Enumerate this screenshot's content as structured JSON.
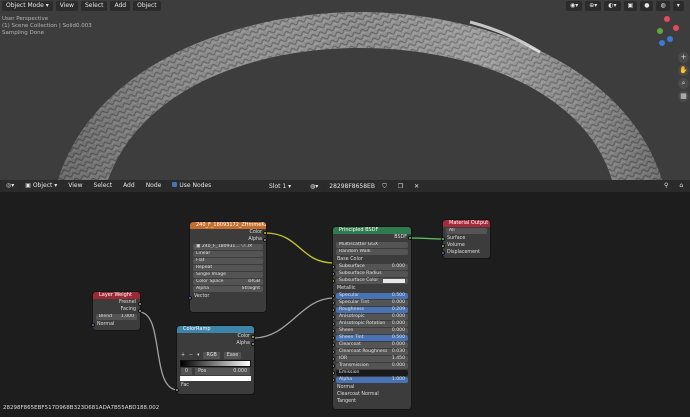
{
  "viewport": {
    "mode_label": "Object Mode",
    "menu": [
      "View",
      "Select",
      "Add",
      "Object"
    ],
    "overlay_lines": [
      "User Perspective",
      "(1) Scene Collection | Solid0.003",
      "Sampling Done"
    ]
  },
  "node_editor": {
    "type_label": "Object",
    "menu": [
      "View",
      "Select",
      "Add",
      "Node"
    ],
    "use_nodes_label": "Use Nodes",
    "slot_label": "Slot 1",
    "material_name": "28298F8658EBF51...",
    "footer_id": "28298F865EBF517D968B323D681ADA7B55ABD188.002"
  },
  "nodes": {
    "image": {
      "title": "240_F_18093172_ZHmmeKzLjpg.001",
      "out_color": "Color",
      "out_alpha": "Alpha",
      "image_name": "240_F_180931...",
      "interpolation": "Linear",
      "projection": "Flat",
      "extension": "Repeat",
      "source": "Single Image",
      "color_space_label": "Color Space",
      "color_space": "sRGB",
      "alpha_label": "Alpha",
      "alpha_value": "Straight",
      "in_vector": "Vector"
    },
    "layer_weight": {
      "title": "Layer Weight",
      "out_fresnel": "Fresnel",
      "out_facing": "Facing",
      "blend_label": "Blend",
      "blend_value": "1.000",
      "in_normal": "Normal"
    },
    "colorramp": {
      "title": "ColorRamp",
      "out_color": "Color",
      "out_alpha": "Alpha",
      "plus": "+",
      "minus": "−",
      "mode": "RGB",
      "interp": "Ease",
      "stop_index": "0",
      "pos_label": "Pos",
      "pos_value": "0.000",
      "in_fac": "Fac"
    },
    "bsdf": {
      "title": "Principled BSDF",
      "out_bsdf": "BSDF",
      "distribution": "Multiscatter GGX",
      "subsurface_method": "Random Walk",
      "fields": [
        {
          "label": "Base Color",
          "value": "",
          "type": "socket-y"
        },
        {
          "label": "Subsurface",
          "value": "0.000",
          "type": "field"
        },
        {
          "label": "Subsurface Radius",
          "value": "",
          "type": "dropdown"
        },
        {
          "label": "Subsurface Color",
          "value": "",
          "type": "color"
        },
        {
          "label": "Metallic",
          "value": "",
          "type": "socket-g"
        },
        {
          "label": "Specular",
          "value": "0.500",
          "type": "blue"
        },
        {
          "label": "Specular Tint",
          "value": "0.000",
          "type": "field"
        },
        {
          "label": "Roughness",
          "value": "0.209",
          "type": "blue"
        },
        {
          "label": "Anisotropic",
          "value": "0.000",
          "type": "field"
        },
        {
          "label": "Anisotropic Rotation",
          "value": "0.000",
          "type": "field"
        },
        {
          "label": "Sheen",
          "value": "0.000",
          "type": "field"
        },
        {
          "label": "Sheen Tint",
          "value": "0.500",
          "type": "blue"
        },
        {
          "label": "Clearcoat",
          "value": "0.000",
          "type": "field"
        },
        {
          "label": "Clearcoat Roughness",
          "value": "0.030",
          "type": "field"
        },
        {
          "label": "IOR",
          "value": "1.450",
          "type": "field"
        },
        {
          "label": "Transmission",
          "value": "0.000",
          "type": "field"
        },
        {
          "label": "Emission",
          "value": "",
          "type": "dark"
        },
        {
          "label": "Alpha",
          "value": "1.000",
          "type": "blue"
        },
        {
          "label": "Normal",
          "value": "",
          "type": "socket-p"
        },
        {
          "label": "Clearcoat Normal",
          "value": "",
          "type": "socket-p"
        },
        {
          "label": "Tangent",
          "value": "",
          "type": "socket-p"
        }
      ]
    },
    "output": {
      "title": "Material Output",
      "target": "All",
      "in_surface": "Surface",
      "in_volume": "Volume",
      "in_displacement": "Displacement"
    }
  },
  "colors": {
    "image_header": "#c46e2e",
    "input_header": "#9a2a35",
    "converter_header": "#3d84a8",
    "shader_header": "#2f7a4f",
    "output_header": "#a52a3a",
    "selected": "#4772b3"
  }
}
